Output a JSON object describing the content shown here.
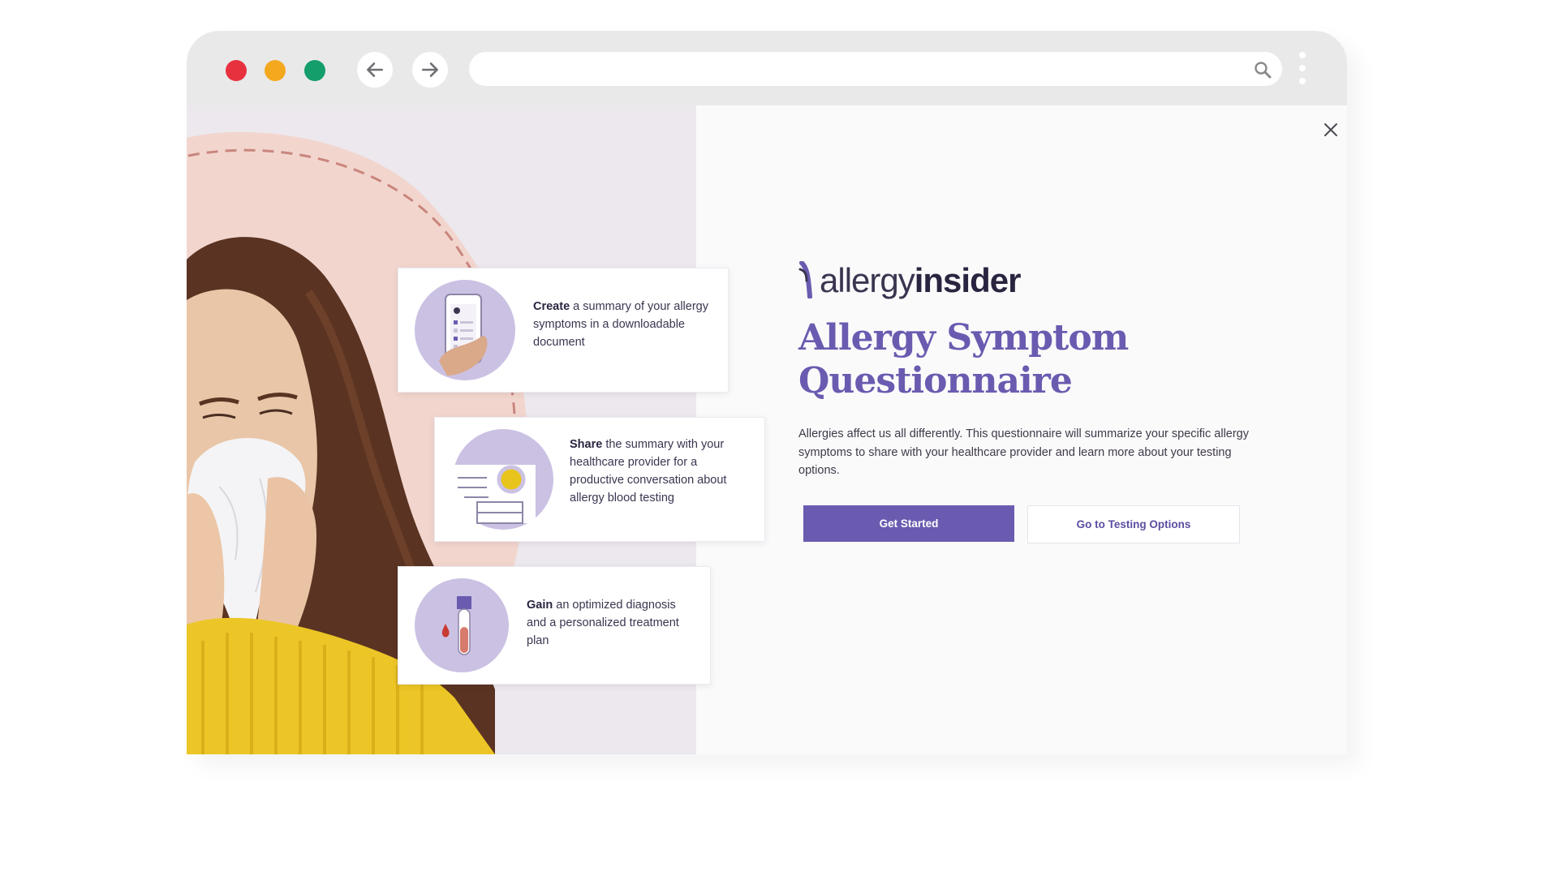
{
  "browser": {
    "colors": {
      "close": "#e8313f",
      "minimize": "#f3a81d",
      "maximize": "#149e6b"
    },
    "icons": {
      "back": "arrow-left-icon",
      "forward": "arrow-right-icon",
      "search": "search-icon",
      "menu": "kebab-menu-icon"
    },
    "url": ""
  },
  "modal": {
    "close_icon": "close-icon",
    "logo": {
      "light": "allergy",
      "bold": "insider"
    },
    "title": "Allergy Symptom Questionnaire",
    "description": "Allergies affect us all differently. This questionnaire will summarize your specific allergy symptoms to share with your healthcare provider and learn more about your testing options.",
    "primary_button": "Get Started",
    "secondary_button": "Go to Testing Options",
    "accent_color": "#6a5bb0"
  },
  "steps": [
    {
      "bold": "Create",
      "text": " a summary of your allergy symptoms in a downloadable document",
      "icon": "phone-checklist-icon"
    },
    {
      "bold": "Share",
      "text": " the summary with your healthcare provider for a productive conversation about allergy blood testing",
      "icon": "document-share-icon"
    },
    {
      "bold": "Gain",
      "text": " an optimized diagnosis and a personalized treatment plan",
      "icon": "blood-test-tube-icon"
    }
  ]
}
